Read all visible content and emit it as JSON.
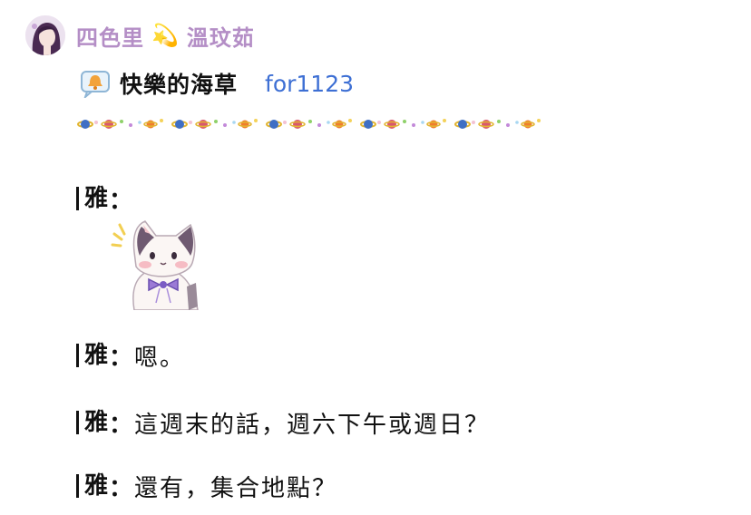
{
  "author": {
    "name": "四色里",
    "separator": "💫",
    "name2": "溫玟茹"
  },
  "post": {
    "title": "快樂的海草",
    "tag": "for1123"
  },
  "icons": {
    "avatar": "avatar-image",
    "bell": "bell-icon",
    "divider": "planet-divider",
    "sticker": "cat-sticker"
  },
  "messages": [
    {
      "speaker": "雅",
      "colon": "：",
      "text": ""
    },
    {
      "speaker": "雅",
      "colon": "：",
      "text": "嗯。"
    },
    {
      "speaker": "雅",
      "colon": "：",
      "text": "這週末的話，週六下午或週日？"
    },
    {
      "speaker": "雅",
      "colon": "：",
      "text": "還有，集合地點？"
    }
  ],
  "colors": {
    "author": "#b48ec6",
    "tag": "#3d6fd4",
    "text": "#111111"
  }
}
